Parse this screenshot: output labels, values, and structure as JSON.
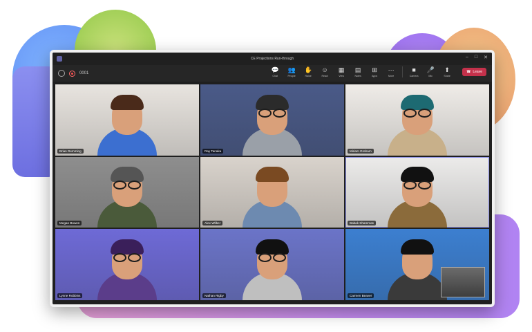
{
  "window": {
    "title": "CE Projections Run-through",
    "timer": "0001"
  },
  "toolbar": {
    "buttons": [
      {
        "label": "Chat",
        "icon": "chat-icon",
        "glyph": "💬"
      },
      {
        "label": "People",
        "icon": "people-icon",
        "glyph": "👥"
      },
      {
        "label": "Raise",
        "icon": "raise-hand-icon",
        "glyph": "✋"
      },
      {
        "label": "React",
        "icon": "react-icon",
        "glyph": "☺"
      },
      {
        "label": "View",
        "icon": "view-icon",
        "glyph": "▦"
      },
      {
        "label": "Notes",
        "icon": "notes-icon",
        "glyph": "▤"
      },
      {
        "label": "Apps",
        "icon": "apps-icon",
        "glyph": "⊞"
      },
      {
        "label": "More",
        "icon": "more-icon",
        "glyph": "⋯"
      },
      {
        "label": "Camera",
        "icon": "camera-icon",
        "glyph": "■"
      },
      {
        "label": "Mic",
        "icon": "mic-icon",
        "glyph": "🎤"
      },
      {
        "label": "Share",
        "icon": "share-icon",
        "glyph": "⬆"
      }
    ],
    "leave_label": "Leave"
  },
  "participants": [
    {
      "name": "Brian Demming",
      "bg": "#e8e4df",
      "shirt": "#3c6fd0",
      "hair": "#4a2a1a",
      "glasses": false
    },
    {
      "name": "Ray Tanaka",
      "bg": "#4a5a88",
      "shirt": "#9aa0a8",
      "hair": "#2b2b2b",
      "glasses": true
    },
    {
      "name": "Miriam Graham",
      "bg": "#efece8",
      "shirt": "#c8b08a",
      "hair": "#1d6a72",
      "glasses": true
    },
    {
      "name": "Megan Bowen",
      "bg": "#8e8e8e",
      "shirt": "#4a5a3a",
      "hair": "#555555",
      "glasses": true
    },
    {
      "name": "Alex Wilber",
      "bg": "#d9d3cc",
      "shirt": "#6d8ab0",
      "hair": "#7a4a22",
      "glasses": false
    },
    {
      "name": "Babak Shammas",
      "bg": "#ecebea",
      "shirt": "#8b6b3b",
      "hair": "#111111",
      "glasses": true
    },
    {
      "name": "Lynne Robbins",
      "bg": "#6e6ad6",
      "shirt": "#5b3d8a",
      "hair": "#3a1f5a",
      "glasses": true
    },
    {
      "name": "Nathan Rigby",
      "bg": "#6b74c8",
      "shirt": "#bfbfbf",
      "hair": "#111111",
      "glasses": true
    },
    {
      "name": "Carmen Beaver",
      "bg": "#3c7fd0",
      "shirt": "#3a3a3a",
      "hair": "#111111",
      "glasses": false
    }
  ],
  "active_tiles": [
    5
  ]
}
